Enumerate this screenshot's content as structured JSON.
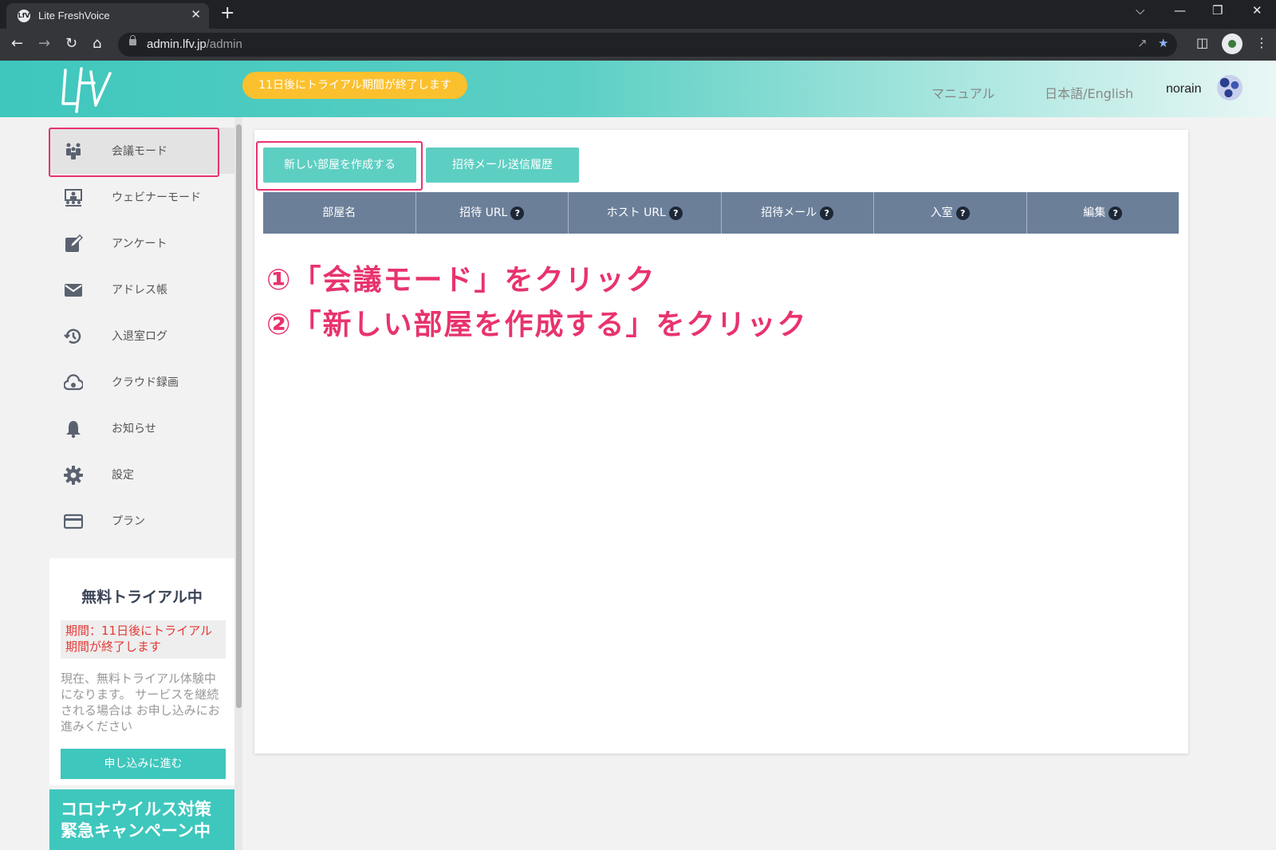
{
  "browser": {
    "tab_title": "Lite FreshVoice",
    "tab_favicon": "LfV",
    "tab_close": "✕",
    "new_tab": "+",
    "url_host": "admin.lfv.jp",
    "url_path": "/admin",
    "controls": {
      "dropdown": "⌵",
      "minimize": "—",
      "restore": "❐",
      "close": "✕"
    }
  },
  "header": {
    "logo": "LFV",
    "trial_banner": "11日後にトライアル期間が終了します",
    "manual_link": "マニュアル",
    "language_link": "日本語/English",
    "username": "norain"
  },
  "sidebar": {
    "items": [
      {
        "label": "会議モード",
        "icon": "meeting-icon"
      },
      {
        "label": "ウェビナーモード",
        "icon": "webinar-icon"
      },
      {
        "label": "アンケート",
        "icon": "edit-icon"
      },
      {
        "label": "アドレス帳",
        "icon": "mail-icon"
      },
      {
        "label": "入退室ログ",
        "icon": "history-icon"
      },
      {
        "label": "クラウド録画",
        "icon": "cloud-icon"
      },
      {
        "label": "お知らせ",
        "icon": "bell-icon"
      },
      {
        "label": "設定",
        "icon": "gear-icon"
      },
      {
        "label": "プラン",
        "icon": "card-icon"
      }
    ],
    "trial": {
      "title": "無料トライアル中",
      "period": "期間：11日後にトライアル期間が終了します",
      "note": "現在、無料トライアル体験中 になります。 サービスを継続される場合は お申し込みにお進みください",
      "apply_button": "申し込みに進む"
    },
    "campaign": {
      "line1": "コロナウイルス対策",
      "line2": "緊急キャンペーン中"
    }
  },
  "main": {
    "create_room_button": "新しい部屋を作成する",
    "invite_history_button": "招待メール送信履歴",
    "table": {
      "columns": [
        "部屋名",
        "招待 URL",
        "ホスト URL",
        "招待メール",
        "入室",
        "編集"
      ],
      "help_mark": "?"
    }
  },
  "annotations": {
    "step1": "①「会議モード」をクリック",
    "step2": "②「新しい部屋を作成する」をクリック",
    "highlight_color": "#e8336d"
  },
  "colors": {
    "accent": "#3ec7bd",
    "button": "#5dcfc2",
    "table_header": "#6b7f99",
    "trial_pill": "#fbc02d"
  }
}
